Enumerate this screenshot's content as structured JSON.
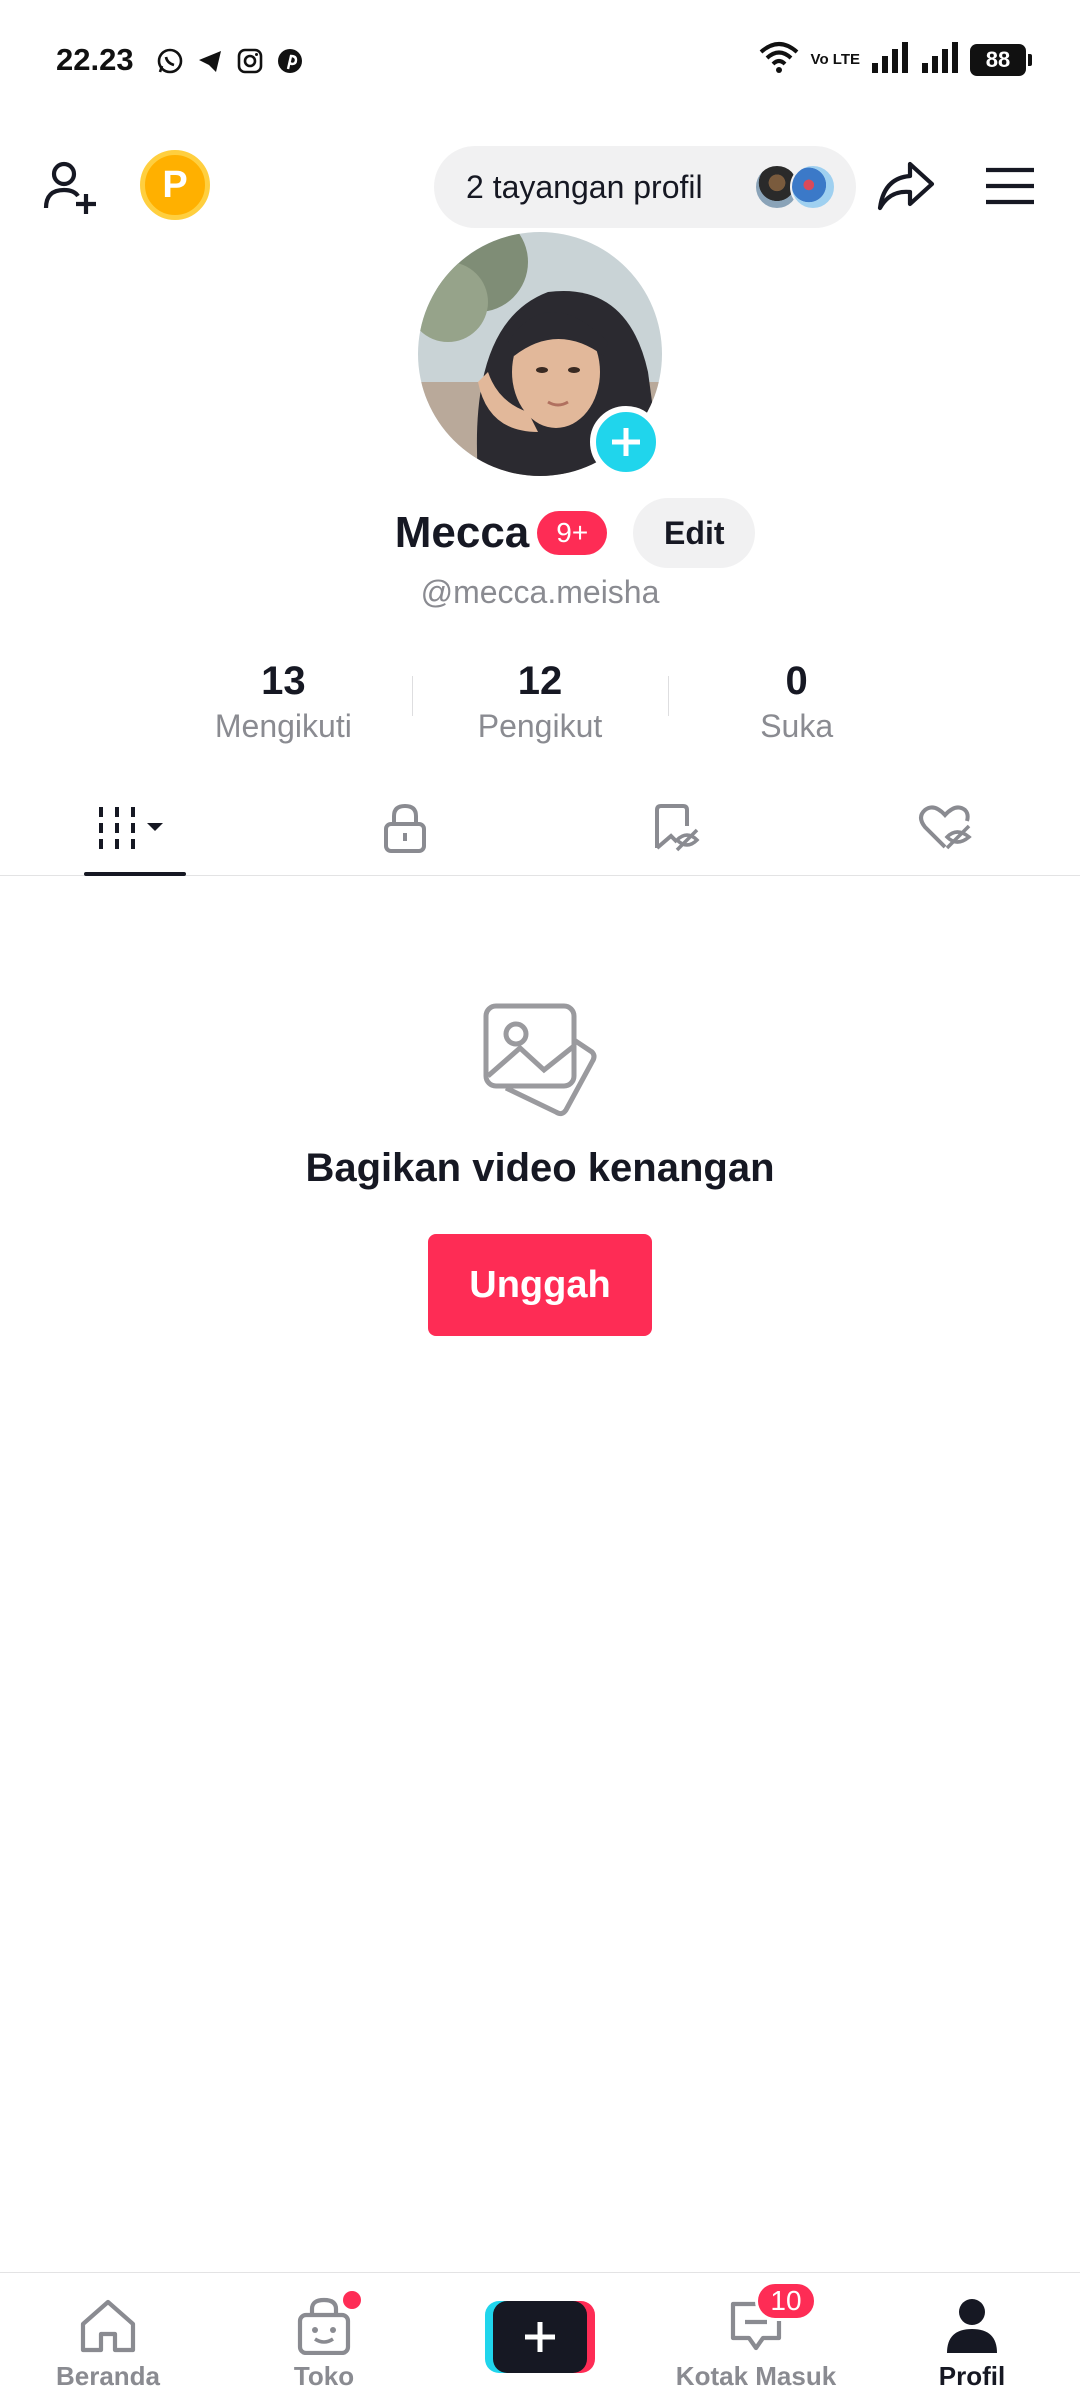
{
  "status_bar": {
    "time": "22.23",
    "volte": "Vo LTE",
    "battery": "88",
    "app_icons": [
      "whatsapp-icon",
      "telegram-icon",
      "instagram-icon",
      "pinterest-icon"
    ]
  },
  "top_bar": {
    "points_letter": "P",
    "profile_views": "2 tayangan profil"
  },
  "profile": {
    "name": "Mecca",
    "badge": "9+",
    "edit_label": "Edit",
    "username": "@mecca.meisha"
  },
  "stats": [
    {
      "value": "13",
      "label": "Mengikuti"
    },
    {
      "value": "12",
      "label": "Pengikut"
    },
    {
      "value": "0",
      "label": "Suka"
    }
  ],
  "tabs": [
    {
      "icon": "videos-grid-icon",
      "active": true
    },
    {
      "icon": "lock-icon",
      "active": false
    },
    {
      "icon": "favorites-hidden-icon",
      "active": false
    },
    {
      "icon": "liked-hidden-icon",
      "active": false
    }
  ],
  "empty_state": {
    "icon": "photos-icon",
    "title": "Bagikan video kenangan",
    "button": "Unggah"
  },
  "bottom_nav": {
    "home": "Beranda",
    "shop": "Toko",
    "inbox": "Kotak Masuk",
    "inbox_count": "10",
    "profile": "Profil"
  },
  "colors": {
    "accent": "#fe2c55",
    "cyan": "#20d5ec",
    "text": "#161823",
    "muted": "#8a8b91"
  }
}
